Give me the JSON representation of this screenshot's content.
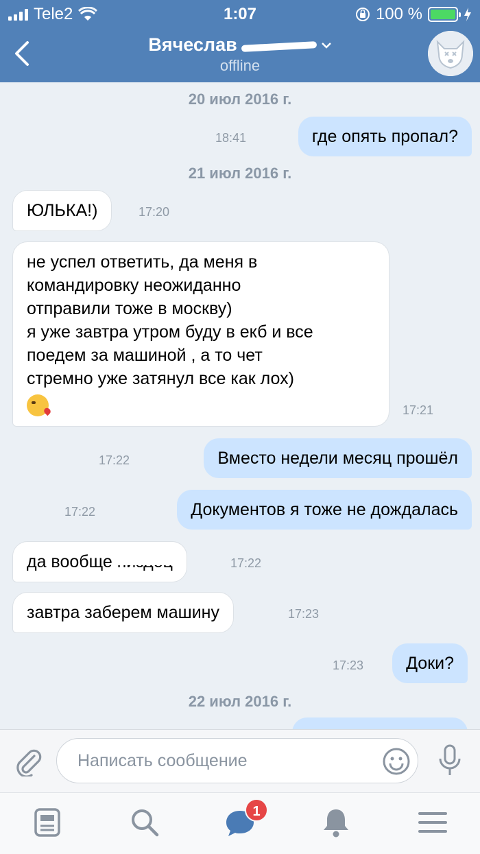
{
  "status_bar": {
    "carrier": "Tele2",
    "time": "1:07",
    "battery_text": "100 %",
    "battery_level": 1.0
  },
  "header": {
    "title": "Вячеслав",
    "subtitle": "offline"
  },
  "dates": [
    "20 июл 2016 г.",
    "21 июл 2016 г.",
    "22 июл 2016 г."
  ],
  "messages": [
    {
      "direction": "out",
      "text": "где опять пропал?",
      "time": "18:41"
    },
    {
      "direction": "in",
      "text": "ЮЛЬКА!)",
      "time": "17:20"
    },
    {
      "direction": "in",
      "lines": [
        "не успел ответить, да меня в",
        "командировку неожиданно",
        "отправили тоже в москву)",
        "я уже завтра утром буду в екб и все",
        "поедем за машиной , а то чет",
        "стремно уже затянул все как лох)"
      ],
      "emoji": "kissing-face-emoji",
      "time": "17:21"
    },
    {
      "direction": "out",
      "text": "Вместо недели месяц прошёл",
      "time": "17:22"
    },
    {
      "direction": "out",
      "text": "Документов я тоже не дождалась",
      "time": "17:22"
    },
    {
      "direction": "in",
      "text": "да вообще",
      "hidden_word": "пиздец",
      "time": "17:22"
    },
    {
      "direction": "in",
      "text": "завтра заберем машину",
      "time": "17:23"
    },
    {
      "direction": "out",
      "text": "Доки?",
      "time": "17:23"
    }
  ],
  "composer": {
    "placeholder": "Написать сообщение",
    "icons": [
      "paperclip-icon",
      "smiley-icon",
      "microphone-icon"
    ]
  },
  "tabbar": {
    "items": [
      "news-icon",
      "search-icon",
      "messages-icon",
      "notifications-icon",
      "menu-icon"
    ],
    "messages_badge": "1"
  },
  "colors": {
    "header": "#5181b8",
    "background": "#ebf0f5",
    "outgoing_bubble": "#cce4ff",
    "incoming_bubble": "#ffffff",
    "badge": "#e64646",
    "battery": "#4cd964"
  }
}
